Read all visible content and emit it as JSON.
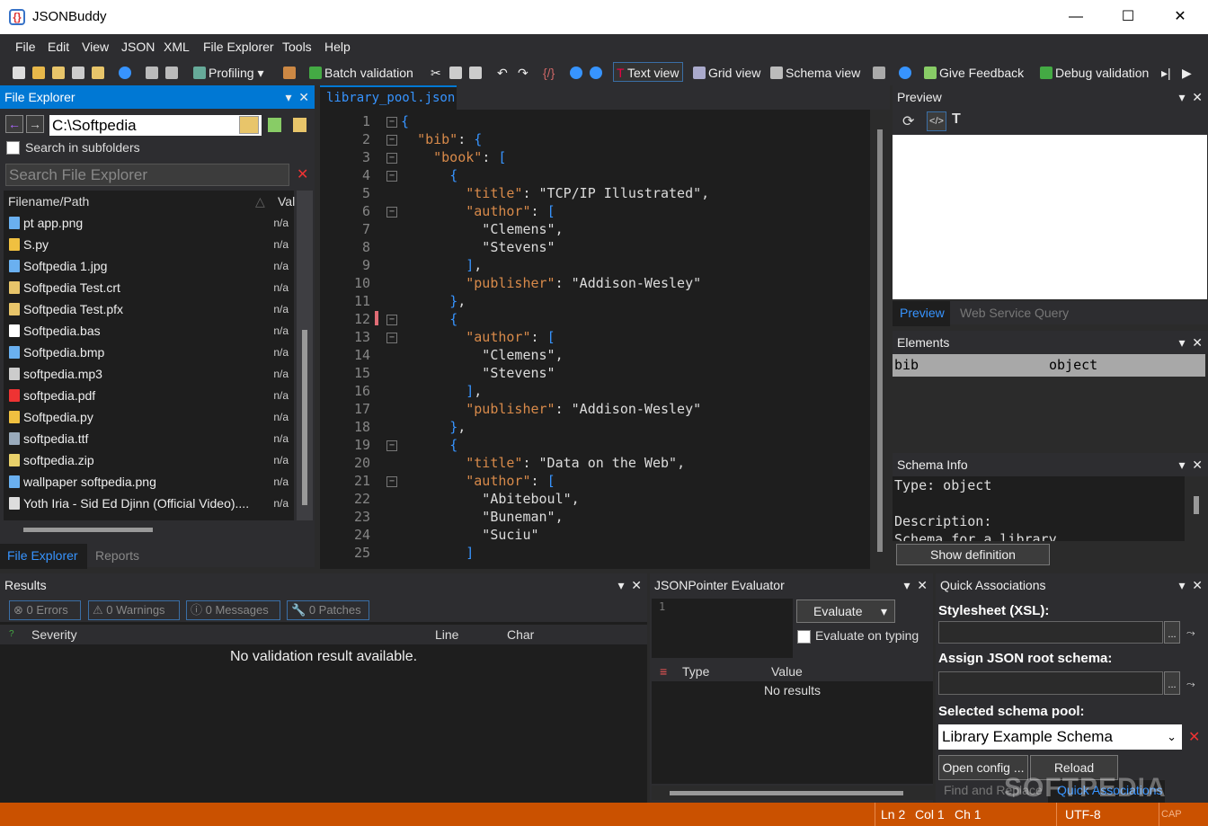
{
  "app": {
    "title": "JSONBuddy"
  },
  "window_controls": {
    "minimize": "—",
    "maximize": "☐",
    "close": "✕"
  },
  "menu": [
    "File",
    "Edit",
    "View",
    "JSON",
    "XML",
    "File Explorer",
    "Tools",
    "Help"
  ],
  "toolbar": {
    "profiling": "Profiling",
    "batch_validation": "Batch validation",
    "text_view": "Text view",
    "grid_view": "Grid view",
    "schema_view": "Schema view",
    "give_feedback": "Give Feedback",
    "debug_validation": "Debug validation"
  },
  "file_explorer": {
    "header": "File Explorer",
    "path": "C:\\Softpedia",
    "search_subfolders": "Search in subfolders",
    "search_placeholder": "Search File Explorer",
    "col_filename": "Filename/Path",
    "col_value": "Val",
    "files": [
      {
        "name": "pt app.png",
        "val": "n/a"
      },
      {
        "name": "S.py",
        "val": "n/a"
      },
      {
        "name": "Softpedia 1.jpg",
        "val": "n/a"
      },
      {
        "name": "Softpedia Test.crt",
        "val": "n/a"
      },
      {
        "name": "Softpedia Test.pfx",
        "val": "n/a"
      },
      {
        "name": "Softpedia.bas",
        "val": "n/a"
      },
      {
        "name": "Softpedia.bmp",
        "val": "n/a"
      },
      {
        "name": "softpedia.mp3",
        "val": "n/a"
      },
      {
        "name": "softpedia.pdf",
        "val": "n/a"
      },
      {
        "name": "Softpedia.py",
        "val": "n/a"
      },
      {
        "name": "softpedia.ttf",
        "val": "n/a"
      },
      {
        "name": "softpedia.zip",
        "val": "n/a"
      },
      {
        "name": "wallpaper softpedia.png",
        "val": "n/a"
      },
      {
        "name": "Yoth Iria - Sid Ed Djinn (Official Video)....",
        "val": "n/a"
      }
    ],
    "tabs": [
      "File Explorer",
      "Reports"
    ]
  },
  "editor": {
    "tab": "library_pool.json",
    "lines": [
      "{",
      "  \"bib\": {",
      "    \"book\": [",
      "      {",
      "        \"title\": \"TCP/IP Illustrated\",",
      "        \"author\": [",
      "          \"Clemens\",",
      "          \"Stevens\"",
      "        ],",
      "        \"publisher\": \"Addison-Wesley\"",
      "      },",
      "      {",
      "        \"author\": [",
      "          \"Clemens\",",
      "          \"Stevens\"",
      "        ],",
      "        \"publisher\": \"Addison-Wesley\"",
      "      },",
      "      {",
      "        \"title\": \"Data on the Web\",",
      "        \"author\": [",
      "          \"Abiteboul\",",
      "          \"Buneman\",",
      "          \"Suciu\"",
      "        ]"
    ]
  },
  "preview": {
    "header": "Preview",
    "tabs": [
      "Preview",
      "Web Service Query"
    ]
  },
  "elements": {
    "header": "Elements",
    "rows": [
      {
        "name": "bib",
        "type": "object"
      }
    ]
  },
  "schema_info": {
    "header": "Schema Info",
    "type_line": "Type: object",
    "desc_label": "Description:",
    "desc_text": "Schema for a library",
    "show_definition": "Show definition"
  },
  "results": {
    "header": "Results",
    "errors": "0 Errors",
    "warnings": "0 Warnings",
    "messages": "0 Messages",
    "patches": "0 Patches",
    "col_severity": "Severity",
    "col_line": "Line",
    "col_char": "Char",
    "empty": "No validation result available."
  },
  "jsonpointer": {
    "header": "JSONPointer Evaluator",
    "line_no": "1",
    "evaluate": "Evaluate",
    "evaluate_on_typing": "Evaluate on typing",
    "col_type": "Type",
    "col_value": "Value",
    "no_results": "No results"
  },
  "quick_assoc": {
    "header": "Quick Associations",
    "stylesheet_label": "Stylesheet (XSL):",
    "root_schema_label": "Assign JSON root schema:",
    "pool_label": "Selected schema pool:",
    "pool_value": "Library Example Schema",
    "open_config": "Open config ...",
    "reload": "Reload",
    "browse": "...",
    "tabs": [
      "Find and Replace",
      "Quick Associations"
    ]
  },
  "status": {
    "ln": "Ln 2",
    "col": "Col 1",
    "ch": "Ch 1",
    "encoding": "UTF-8",
    "cap": "CAP"
  },
  "watermark": "SOFTPEDIA",
  "colors": {
    "accent": "#0078d4",
    "status_bar": "#ca5100",
    "editor_bg": "#1e1e1e"
  }
}
